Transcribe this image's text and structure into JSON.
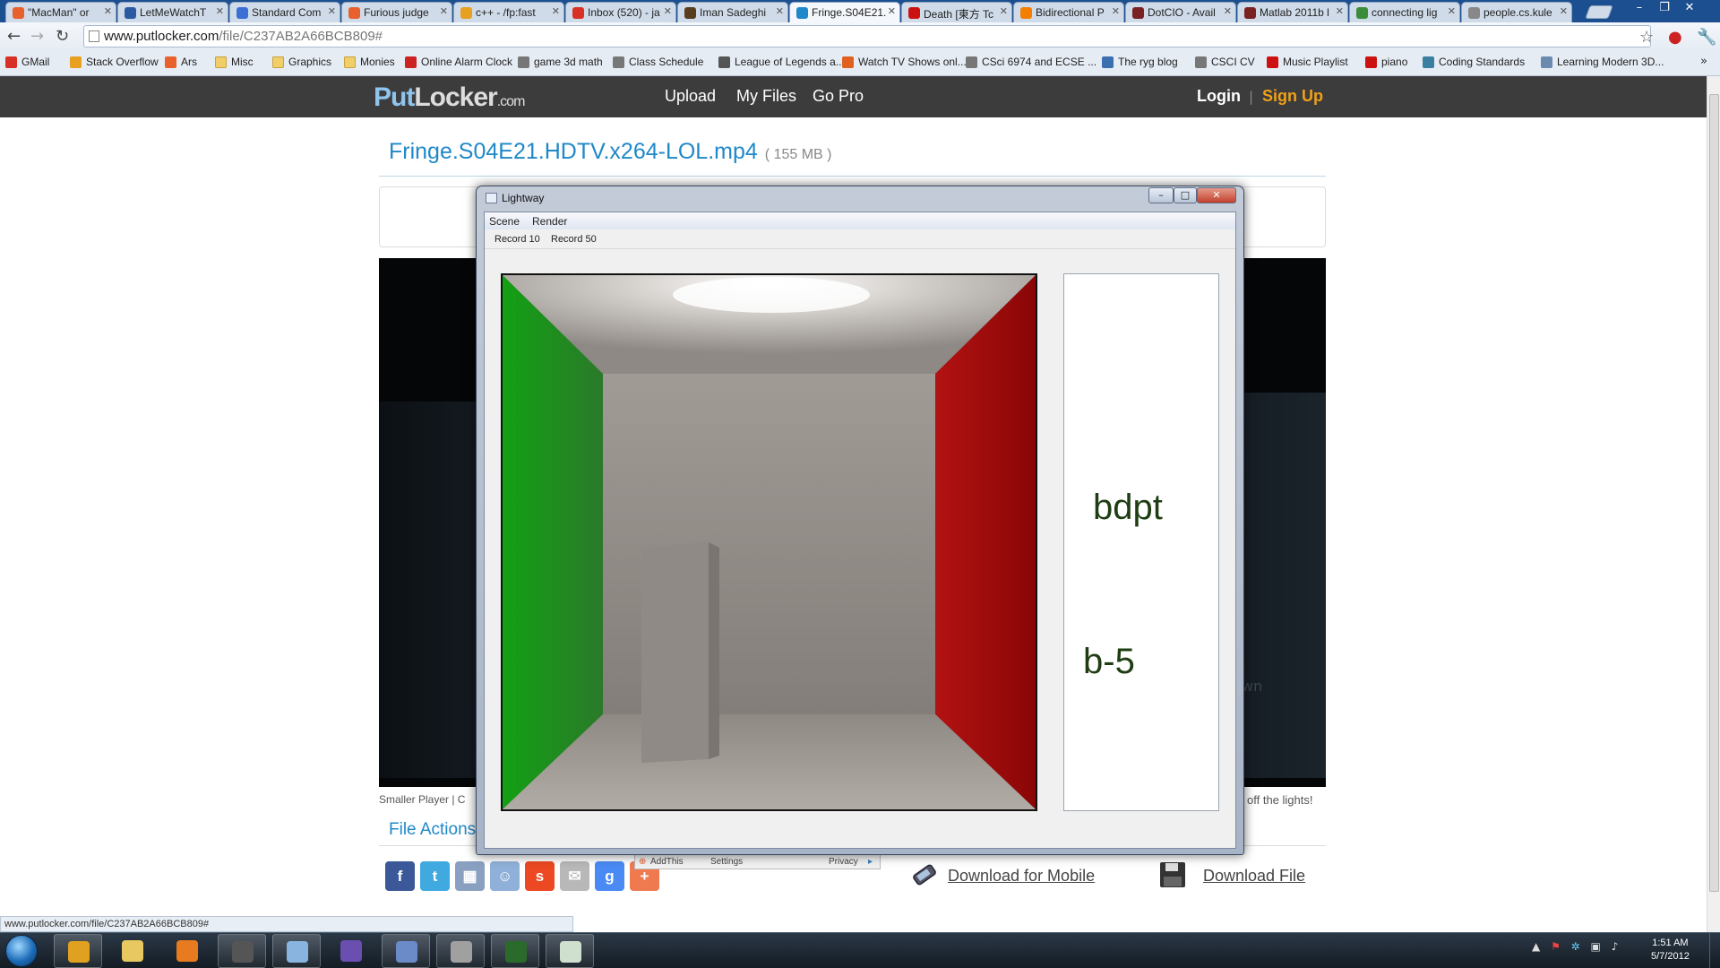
{
  "browser": {
    "tabs": [
      {
        "label": "\"MacMan\" or",
        "fav_color": "#e8612c"
      },
      {
        "label": "LetMeWatchT",
        "fav_color": "#2c5aa0"
      },
      {
        "label": "Standard Com",
        "fav_color": "#3b6fd4"
      },
      {
        "label": "Furious judge",
        "fav_color": "#e8612c"
      },
      {
        "label": "c++ - /fp:fast",
        "fav_color": "#e8a020"
      },
      {
        "label": "Inbox (520) - ja",
        "fav_color": "#d93025"
      },
      {
        "label": "Iman Sadeghi",
        "fav_color": "#5a3d1e"
      },
      {
        "label": "Fringe.S04E21.",
        "fav_color": "#1f88c8",
        "active": true
      },
      {
        "label": "Death [東方 Tc",
        "fav_color": "#cc1111"
      },
      {
        "label": "Bidirectional P",
        "fav_color": "#f57d00"
      },
      {
        "label": "DotCIO - Avail",
        "fav_color": "#7a2222"
      },
      {
        "label": "Matlab 2011b l",
        "fav_color": "#7a2222"
      },
      {
        "label": "connecting lig",
        "fav_color": "#3b8d3b"
      },
      {
        "label": "people.cs.kule",
        "fav_color": "#888888"
      }
    ],
    "url_host": "www.putlocker.com",
    "url_path": "/file/C237AB2A66BCB809#",
    "bookmarks": [
      {
        "label": "GMail",
        "color": "#d93025"
      },
      {
        "label": "Stack Overflow",
        "color": "#e8a020"
      },
      {
        "label": "Ars",
        "color": "#e8612c"
      },
      {
        "label": "Misc",
        "folder": true
      },
      {
        "label": "Graphics",
        "folder": true
      },
      {
        "label": "Monies",
        "folder": true
      },
      {
        "label": "Online Alarm Clock",
        "color": "#cc2222"
      },
      {
        "label": "game 3d math",
        "color": "#777777"
      },
      {
        "label": "Class Schedule",
        "color": "#777777"
      },
      {
        "label": "League of Legends a...",
        "color": "#555555"
      },
      {
        "label": "Watch TV Shows onl...",
        "color": "#e06020"
      },
      {
        "label": "CSci 6974 and ECSE ...",
        "color": "#777777"
      },
      {
        "label": "The ryg blog",
        "color": "#3a6fb0"
      },
      {
        "label": "CSCI CV",
        "color": "#777777"
      },
      {
        "label": "Music Playlist",
        "color": "#cc1111"
      },
      {
        "label": "piano",
        "color": "#cc1111"
      },
      {
        "label": "Coding Standards",
        "color": "#3a7fa0"
      },
      {
        "label": "Learning Modern 3D...",
        "color": "#6a8ab0"
      }
    ],
    "status_text": "www.putlocker.com/file/C237AB2A66BCB809#"
  },
  "site": {
    "logo_put": "Put",
    "logo_locker": "Locker",
    "logo_com": ".com",
    "nav": [
      "Upload",
      "My Files",
      "Go Pro"
    ],
    "login": "Login",
    "separator": "|",
    "signup": "Sign Up",
    "file_title": "Fringe.S04E21.HDTV.x264-LOL.mp4",
    "file_size": "( 155 MB )",
    "smaller_player": "Smaller Player | C",
    "lights_text": "off the lights!",
    "player_watermark": "wn",
    "file_actions": "File Actions",
    "addthis": {
      "brand": "AddThis",
      "settings": "Settings",
      "privacy": "Privacy"
    },
    "share_icons": [
      {
        "name": "facebook",
        "glyph": "f",
        "color": "#3b5998"
      },
      {
        "name": "twitter",
        "glyph": "t",
        "color": "#3fa9e0"
      },
      {
        "name": "delicious",
        "glyph": "▦",
        "color": "#8aa0c0"
      },
      {
        "name": "reddit",
        "glyph": "☺",
        "color": "#8fb0d8"
      },
      {
        "name": "stumbleupon",
        "glyph": "s",
        "color": "#eb4823"
      },
      {
        "name": "email",
        "glyph": "✉",
        "color": "#b8b8b8"
      },
      {
        "name": "google",
        "glyph": "g",
        "color": "#4a8af4"
      },
      {
        "name": "more",
        "glyph": "+",
        "color": "#f07a50"
      }
    ],
    "download_mobile": "Download for Mobile",
    "download_file": "Download File"
  },
  "lightway": {
    "title": "Lightway",
    "win_buttons": {
      "minimize": "–",
      "maximize": "□",
      "close": "✕"
    },
    "menu": [
      "Scene",
      "Render"
    ],
    "toolbar": [
      "Record 10",
      "Record 50"
    ],
    "label_top": "bdpt",
    "label_bottom": "b-5",
    "colors": {
      "left_wall": "#1a9a1a",
      "right_wall": "#a50d0d",
      "back_wall": "#8a8580",
      "floor": "#9a948e",
      "ceiling": "#b7b1ab"
    }
  },
  "taskbar": {
    "apps": [
      {
        "name": "chrome",
        "color": "#e0a020",
        "open": true
      },
      {
        "name": "explorer",
        "color": "#e8c860",
        "open": false
      },
      {
        "name": "media-player",
        "color": "#e87a20",
        "open": false
      },
      {
        "name": "sublime",
        "color": "#555555",
        "open": true
      },
      {
        "name": "notepad-plus",
        "color": "#8ab4e0",
        "open": true
      },
      {
        "name": "visual-studio",
        "color": "#6a4fb0",
        "open": false
      },
      {
        "name": "paint",
        "color": "#6a8ac8",
        "open": true
      },
      {
        "name": "dev-tool",
        "color": "#a0a0a0",
        "open": true
      },
      {
        "name": "terminal",
        "color": "#2a6a2a",
        "open": true
      },
      {
        "name": "lightway",
        "color": "#cfe0cf",
        "open": true
      }
    ],
    "time": "1:51 AM",
    "date": "5/7/2012"
  }
}
